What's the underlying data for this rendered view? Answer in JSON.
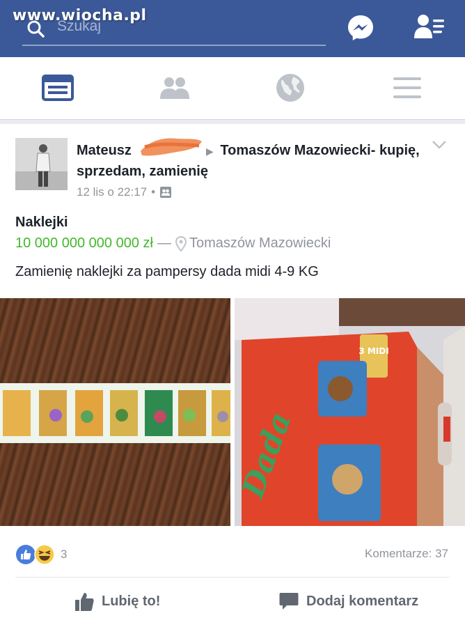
{
  "watermark": "www.wiocha.pl",
  "search": {
    "placeholder": "Szukaj"
  },
  "nav": {
    "tabs": [
      {
        "icon": "news-feed-icon",
        "active": true
      },
      {
        "icon": "groups-icon",
        "active": false
      },
      {
        "icon": "globe-icon",
        "active": false
      },
      {
        "icon": "menu-icon",
        "active": false
      }
    ]
  },
  "colors": {
    "brand": "#3b5998",
    "price": "#42b72a",
    "muted": "#90949c"
  },
  "post": {
    "author": "Mateusz",
    "group": "Tomaszów Mazowiecki- kupię, sprzedam, zamienię",
    "time": "12 lis o 22:17",
    "dot": "•",
    "item_title": "Naklejki",
    "price": "10 000 000 000 000 zł",
    "dash": "—",
    "location": "Tomaszów Mazowiecki",
    "text": "Zamienię naklejki za pampersy dada midi 4-9 KG",
    "reaction_count": "3",
    "comments": "Komentarze: 37",
    "like_label": "Lubię to!",
    "comment_label": "Dodaj komentarz",
    "box_brand": "Dada",
    "box_size": "3 MIDI"
  }
}
